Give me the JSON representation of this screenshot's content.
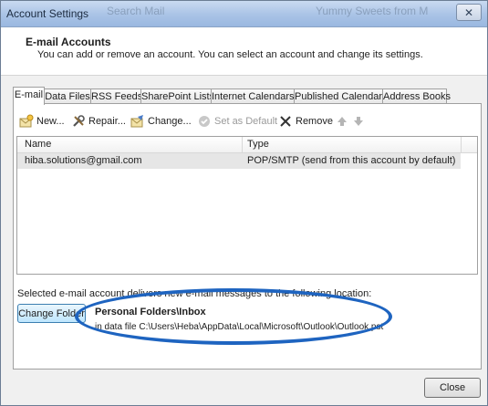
{
  "window": {
    "title": "Account Settings",
    "background_text_1": "Search Mail",
    "background_text_2": "Yummy Sweets from M",
    "close_glyph": "✕"
  },
  "header": {
    "title": "E-mail Accounts",
    "subtitle": "You can add or remove an account. You can select an account and change its settings."
  },
  "tabs": [
    {
      "label": "E-mail"
    },
    {
      "label": "Data Files"
    },
    {
      "label": "RSS Feeds"
    },
    {
      "label": "SharePoint Lists"
    },
    {
      "label": "Internet Calendars"
    },
    {
      "label": "Published Calendars"
    },
    {
      "label": "Address Books"
    }
  ],
  "toolbar": {
    "new_label": "New...",
    "repair_label": "Repair...",
    "change_label": "Change...",
    "set_default_label": "Set as Default",
    "remove_label": "Remove"
  },
  "list": {
    "col_name": "Name",
    "col_type": "Type",
    "rows": [
      {
        "name": "hiba.solutions@gmail.com",
        "type": "POP/SMTP (send from this account by default)"
      }
    ]
  },
  "delivery": {
    "text": "Selected e-mail account delivers new e-mail messages to the following location:",
    "change_folder_label": "Change Folder",
    "folder": "Personal Folders\\Inbox",
    "path": "in data file C:\\Users\\Heba\\AppData\\Local\\Microsoft\\Outlook\\Outlook.pst"
  },
  "footer": {
    "close_label": "Close"
  },
  "colors": {
    "highlight_ellipse": "#1e64c0",
    "selected_row": "#e6e6e6"
  }
}
